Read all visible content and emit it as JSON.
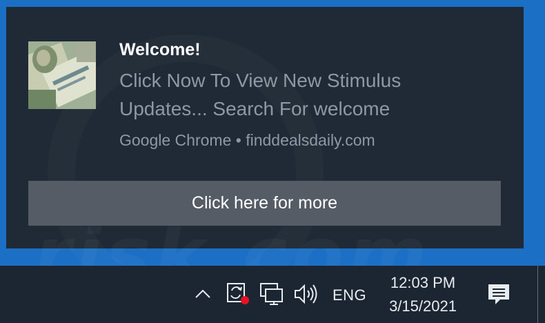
{
  "notification": {
    "title": "Welcome!",
    "message": "Click Now To View New Stimulus Updates... Search For welcome",
    "source": "Google Chrome • finddealsdaily.com",
    "action_label": "Click here for more",
    "thumbnail_icon": "stimulus-check-image"
  },
  "watermark": {
    "text": "risk.com"
  },
  "taskbar": {
    "tray_icons": [
      "chevron-up-icon",
      "sync-icon",
      "network-icon",
      "volume-icon"
    ],
    "language": "ENG",
    "time": "12:03 PM",
    "date": "3/15/2021",
    "notification_center_icon": "action-center-icon"
  },
  "colors": {
    "desktop": "#1b6fc4",
    "toast_bg": "#1f2a36",
    "button_bg": "#555c66",
    "taskbar_bg": "#1c2632",
    "badge_red": "#e81123"
  }
}
